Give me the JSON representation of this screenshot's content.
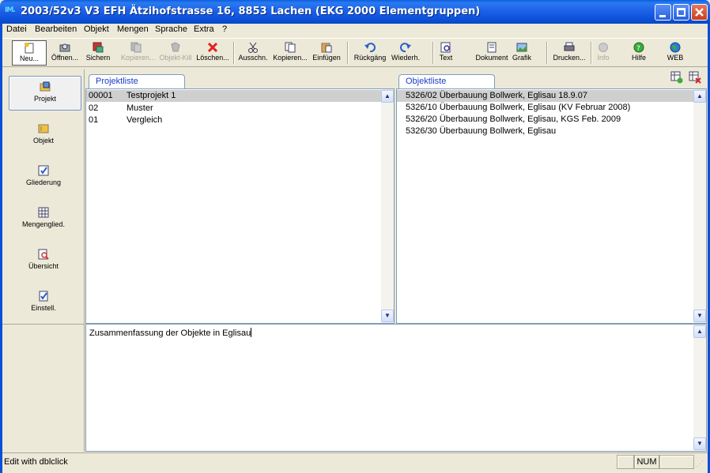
{
  "window": {
    "title": "2003/52v3 V3 EFH Ätzihofstrasse 16, 8853 Lachen (EKG 2000 Elementgruppen)",
    "app_icon": "IM."
  },
  "menu": [
    "Datei",
    "Bearbeiten",
    "Objekt",
    "Mengen",
    "Sprache",
    "Extra",
    "?"
  ],
  "toolbar": {
    "buttons": [
      {
        "label": "Neu...",
        "icon": "new-doc-icon",
        "enabled": true
      },
      {
        "label": "Öffnen...",
        "icon": "open-folder-icon",
        "enabled": true
      },
      {
        "label": "Sichern",
        "icon": "save-icon",
        "enabled": true
      },
      {
        "label": "Kopieren...",
        "icon": "copy-icon",
        "enabled": false
      },
      {
        "label": "Objekt-Kill",
        "icon": "object-kill-icon",
        "enabled": false
      },
      {
        "label": "Löschen...",
        "icon": "delete-x-icon",
        "enabled": true
      },
      {
        "label": "Ausschn.",
        "icon": "cut-icon",
        "enabled": true
      },
      {
        "label": "Kopieren...",
        "icon": "copy-icon",
        "enabled": true
      },
      {
        "label": "Einfügen",
        "icon": "paste-icon",
        "enabled": true
      },
      {
        "label": "Rückgäng",
        "icon": "undo-icon",
        "enabled": true
      },
      {
        "label": "Wiederh.",
        "icon": "redo-icon",
        "enabled": true
      },
      {
        "label": "Text",
        "icon": "text-icon",
        "enabled": true
      },
      {
        "label": "Dokument",
        "icon": "document-icon",
        "enabled": true
      },
      {
        "label": "Grafik",
        "icon": "graphic-icon",
        "enabled": true
      },
      {
        "label": "Drucken...",
        "icon": "printer-icon",
        "enabled": true
      },
      {
        "label": "Info",
        "icon": "info-icon",
        "enabled": false
      },
      {
        "label": "Hilfe",
        "icon": "help-icon",
        "enabled": true
      },
      {
        "label": "WEB",
        "icon": "globe-icon",
        "enabled": true
      }
    ]
  },
  "nav": [
    {
      "label": "Projekt",
      "icon": "project-icon",
      "active": true
    },
    {
      "label": "Objekt",
      "icon": "object-folder-icon",
      "active": false
    },
    {
      "label": "Gliederung",
      "icon": "structure-icon",
      "active": false
    },
    {
      "label": "Mengenglied.",
      "icon": "quantity-grid-icon",
      "active": false
    },
    {
      "label": "Übersicht",
      "icon": "overview-icon",
      "active": false
    },
    {
      "label": "Einstell.",
      "icon": "settings-check-icon",
      "active": false
    }
  ],
  "projects": {
    "tab_label": "Projektliste",
    "rows": [
      {
        "code": "00001",
        "name": "Testprojekt 1",
        "selected": true
      },
      {
        "code": "02",
        "name": "Muster",
        "selected": false
      },
      {
        "code": "01",
        "name": "Vergleich",
        "selected": false
      }
    ]
  },
  "objects": {
    "tab_label": "Objektliste",
    "rows": [
      {
        "name": "5326/02 Überbauung Bollwerk, Eglisau 18.9.07",
        "selected": true
      },
      {
        "name": "5326/10 Überbauung Bollwerk, Eglisau (KV Februar 2008)",
        "selected": false
      },
      {
        "name": "5326/20 Überbauung Bollwerk, Eglisau, KGS Feb. 2009",
        "selected": false
      },
      {
        "name": "5326/30 Überbauung Bollwerk, Eglisau",
        "selected": false
      }
    ]
  },
  "description": {
    "text": "Zusammenfassung der Objekte in Eglisau"
  },
  "status": {
    "text": "Edit with dblclick",
    "num": "NUM"
  },
  "colors": {
    "titlebar": "#0b4fd8",
    "tab_text": "#1a3cc8",
    "selected_row": "#cfcfd0",
    "chrome": "#ece9d8"
  }
}
